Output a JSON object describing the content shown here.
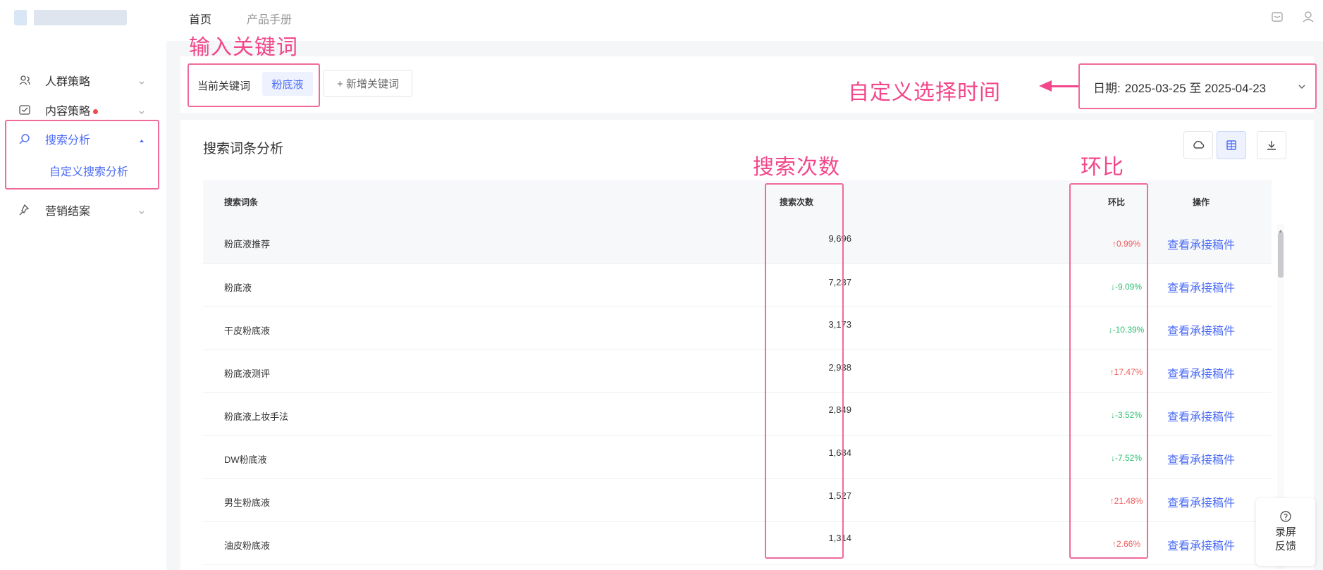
{
  "topbar": {
    "tabs": [
      "首页",
      "产品手册"
    ]
  },
  "sidebar": {
    "items": [
      {
        "label": "人群策略"
      },
      {
        "label": "内容策略"
      },
      {
        "label": "搜索分析"
      },
      {
        "label": "营销结案"
      }
    ],
    "sub_item": "自定义搜索分析"
  },
  "annotations": {
    "keyword": "输入关键词",
    "date": "自定义选择时间",
    "count": "搜索次数",
    "ratio": "环比"
  },
  "keyword_bar": {
    "label": "当前关键词",
    "chip": "粉底液",
    "add": "+ 新增关键词"
  },
  "date_picker": {
    "label": "日期:",
    "value": "2025-03-25 至 2025-04-23"
  },
  "panel": {
    "title": "搜索词条分析",
    "columns": [
      "搜索词条",
      "搜索次数",
      "环比",
      "操作"
    ]
  },
  "rows": [
    {
      "term": "粉底液推荐",
      "count": "9,696",
      "ratio": "↑0.99%",
      "dir": "up",
      "action": "查看承接稿件"
    },
    {
      "term": "粉底液",
      "count": "7,237",
      "ratio": "↓-9.09%",
      "dir": "down",
      "action": "查看承接稿件"
    },
    {
      "term": "干皮粉底液",
      "count": "3,173",
      "ratio": "↓-10.39%",
      "dir": "down",
      "action": "查看承接稿件"
    },
    {
      "term": "粉底液测评",
      "count": "2,938",
      "ratio": "↑17.47%",
      "dir": "up",
      "action": "查看承接稿件"
    },
    {
      "term": "粉底液上妆手法",
      "count": "2,849",
      "ratio": "↓-3.52%",
      "dir": "down",
      "action": "查看承接稿件"
    },
    {
      "term": "DW粉底液",
      "count": "1,684",
      "ratio": "↓-7.52%",
      "dir": "down",
      "action": "查看承接稿件"
    },
    {
      "term": "男生粉底液",
      "count": "1,527",
      "ratio": "↑21.48%",
      "dir": "up",
      "action": "查看承接稿件"
    },
    {
      "term": "油皮粉底液",
      "count": "1,314",
      "ratio": "↑2.66%",
      "dir": "up",
      "action": "查看承接稿件"
    }
  ],
  "feedback": {
    "line1": "录屏",
    "line2": "反馈"
  }
}
